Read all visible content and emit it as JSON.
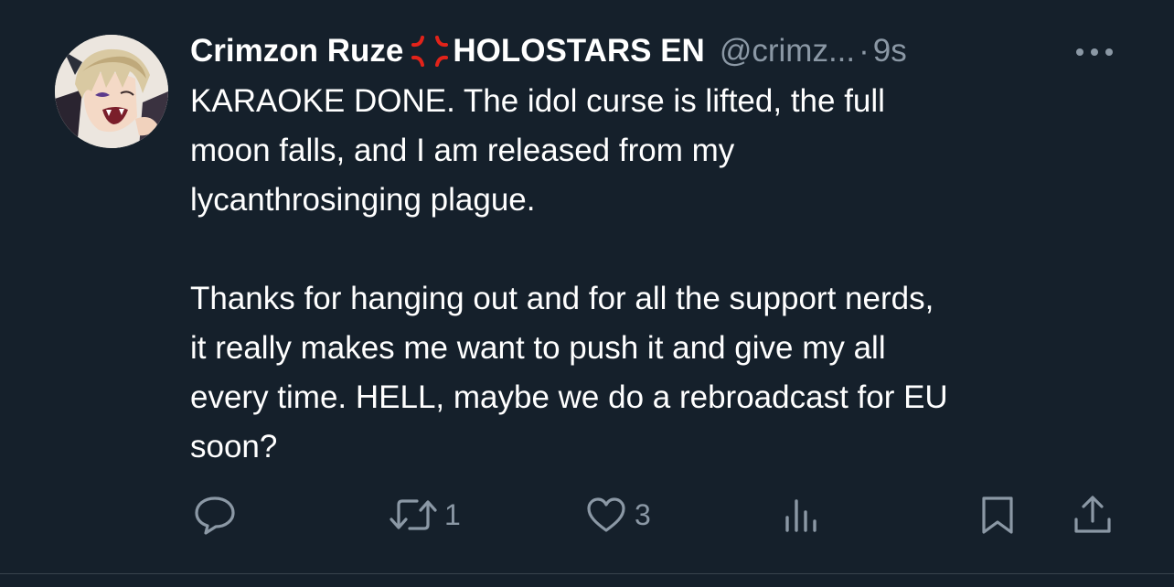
{
  "tweet": {
    "author_name": "Crimzon Ruze",
    "author_suffix": "HOLOSTARS EN",
    "handle": "@crimz...",
    "separator": "·",
    "time": "9s",
    "paragraphs": [
      "KARAOKE DONE.  The idol curse is lifted, the full\nmoon falls, and I am released from my\nlycanthrosinging plague.",
      "Thanks for hanging out and for all the support nerds,\nit really makes me want to push it and give my all\nevery time.  HELL, maybe we do a rebroadcast for EU\nsoon?"
    ]
  },
  "actions": {
    "reply": {
      "icon": "reply-icon"
    },
    "retweet": {
      "icon": "retweet-icon",
      "count": "1"
    },
    "like": {
      "icon": "heart-icon",
      "count": "3"
    },
    "views": {
      "icon": "views-icon"
    },
    "bookmark": {
      "icon": "bookmark-icon"
    },
    "share": {
      "icon": "share-icon"
    }
  },
  "icons": {
    "name_emoji": "anger-symbol-icon",
    "more": "more-dots-icon"
  },
  "colors": {
    "background": "#15202b",
    "text": "#ffffff",
    "muted": "#8b98a5",
    "anger_emoji": "#e2231a"
  }
}
